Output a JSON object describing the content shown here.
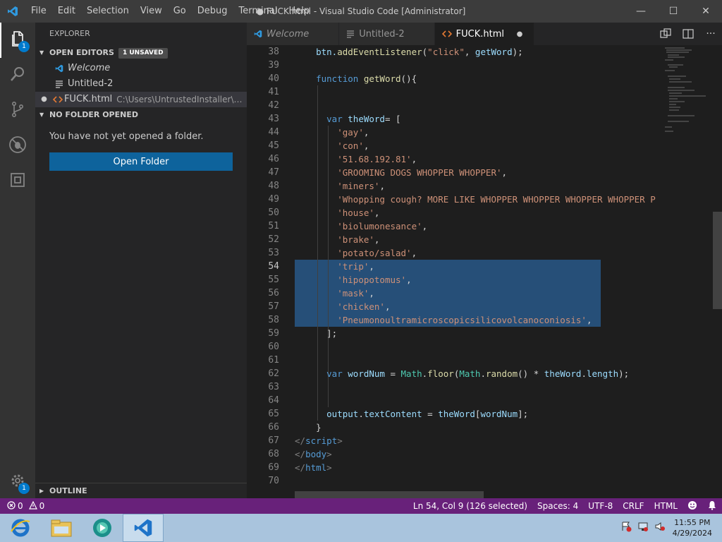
{
  "titlebar": {
    "menu": [
      "File",
      "Edit",
      "Selection",
      "View",
      "Go",
      "Debug",
      "Terminal",
      "Help"
    ],
    "title": "● FUCK.html - Visual Studio Code [Administrator]",
    "minimize": "—",
    "maximize": "☐",
    "close": "✕"
  },
  "activitybar": {
    "items": [
      {
        "icon": "files-icon",
        "badge": "1"
      },
      {
        "icon": "search-icon"
      },
      {
        "icon": "source-control-icon"
      },
      {
        "icon": "debug-icon"
      },
      {
        "icon": "extensions-icon"
      }
    ],
    "settings_badge": "1"
  },
  "sidebar": {
    "header": "EXPLORER",
    "open_editors": {
      "label": "OPEN EDITORS",
      "unsaved": "1 UNSAVED",
      "items": [
        {
          "name": "Welcome",
          "path": ""
        },
        {
          "name": "Untitled-2",
          "path": ""
        },
        {
          "name": "FUCK.html",
          "path": "C:\\Users\\UntrustedInstaller\\Desk..."
        }
      ]
    },
    "no_folder": {
      "label": "NO FOLDER OPENED",
      "message": "You have not yet opened a folder.",
      "button": "Open Folder"
    },
    "outline": "OUTLINE"
  },
  "tabs": [
    {
      "label": "Welcome",
      "active": false
    },
    {
      "label": "Untitled-2",
      "active": false
    },
    {
      "label": "FUCK.html",
      "active": true,
      "dirty": "●"
    }
  ],
  "editor": {
    "line_numbers": [
      "38",
      "39",
      "40",
      "41",
      "42",
      "43",
      "44",
      "45",
      "46",
      "47",
      "48",
      "49",
      "50",
      "51",
      "52",
      "53",
      "54",
      "55",
      "56",
      "57",
      "58",
      "59",
      "60",
      "61",
      "62",
      "63",
      "64",
      "65",
      "66",
      "67",
      "68",
      "69",
      "70"
    ],
    "current_line": "54",
    "code": {
      "l38a": "btn.",
      "l38b": "addEventListener",
      "l38c": "(",
      "l38d": "\"click\"",
      "l38e": ", ",
      "l38f": "getWord",
      "l38g": ");",
      "l40a": "function",
      "l40b": "getWord",
      "l40c": "(){",
      "l43a": "var",
      "l43b": "theWord",
      "l43c": "= [",
      "l44": "'gay'",
      "l45": "'con'",
      "l46": "'51.68.192.81'",
      "l47": "'GROOMING DOGS WHOPPER WHOPPER'",
      "l48": "'miners'",
      "l49": "'Whopping cough? MORE LIKE WHOPPER WHOPPER WHOPPER WHOPPER P",
      "l50": "'house'",
      "l51": "'biolumonesance'",
      "l52": "'brake'",
      "l53": "'potato/salad'",
      "l54": "'trip'",
      "l55": "'hipopotomus'",
      "l56": "'mask'",
      "l57": "'chicken'",
      "l58": "'Pneumonoultramicroscopicsilicovolcanoconiosis'",
      "l59": "];",
      "l62a": "var",
      "l62b": "wordNum",
      "l62c": " = ",
      "l62d": "Math",
      "l62e": ".",
      "l62f": "floor",
      "l62g": "(",
      "l62h": "Math",
      "l62i": ".",
      "l62j": "random",
      "l62k": "() * ",
      "l62l": "theWord",
      "l62m": ".",
      "l62n": "length",
      "l62o": ");",
      "l65a": "output",
      "l65b": ".",
      "l65c": "textContent",
      "l65d": " = ",
      "l65e": "theWord",
      "l65f": "[",
      "l65g": "wordNum",
      "l65h": "];",
      "l66": "}",
      "l67a": "</",
      "l67b": "script",
      "l67c": ">",
      "l68a": "</",
      "l68b": "body",
      "l68c": ">",
      "l69a": "</",
      "l69b": "html",
      "l69c": ">",
      "comma": ","
    }
  },
  "statusbar": {
    "errors": "0",
    "warnings": "0",
    "position": "Ln 54, Col 9 (126 selected)",
    "spaces": "Spaces: 4",
    "encoding": "UTF-8",
    "eol": "CRLF",
    "language": "HTML"
  },
  "taskbar": {
    "time": "11:55 PM",
    "date": "4/29/2024"
  },
  "colors": {
    "statusbar": "#68217a",
    "accent": "#007acc",
    "button": "#0e639c",
    "selection": "#264f78"
  }
}
